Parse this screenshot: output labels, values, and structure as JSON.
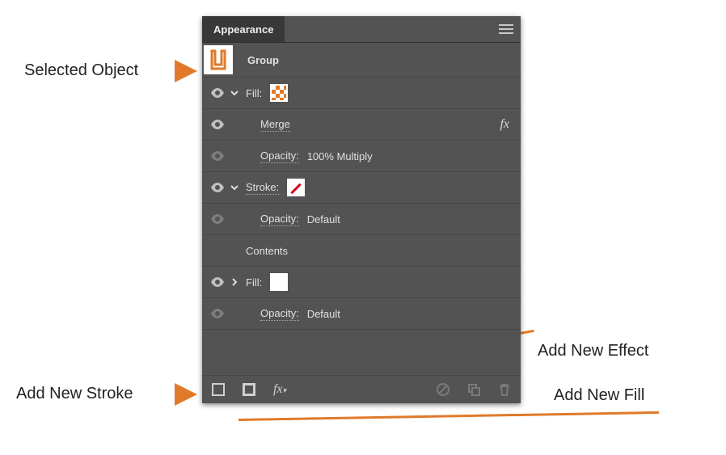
{
  "panel": {
    "tab_label": "Appearance",
    "object_label": "Group",
    "rows": {
      "fill1_label": "Fill:",
      "merge_label": "Merge",
      "opacity1_label": "Opacity:",
      "opacity1_value": "100% Multiply",
      "stroke_label": "Stroke:",
      "opacity2_label": "Opacity:",
      "opacity2_value": "Default",
      "contents_label": "Contents",
      "fill2_label": "Fill:",
      "opacity3_label": "Opacity:",
      "opacity3_value": "Default"
    },
    "fx_symbol": "fx"
  },
  "callouts": {
    "selected_object": "Selected Object",
    "add_new_stroke": "Add New Stroke",
    "add_new_effect": "Add New Effect",
    "add_new_fill": "Add New Fill"
  }
}
